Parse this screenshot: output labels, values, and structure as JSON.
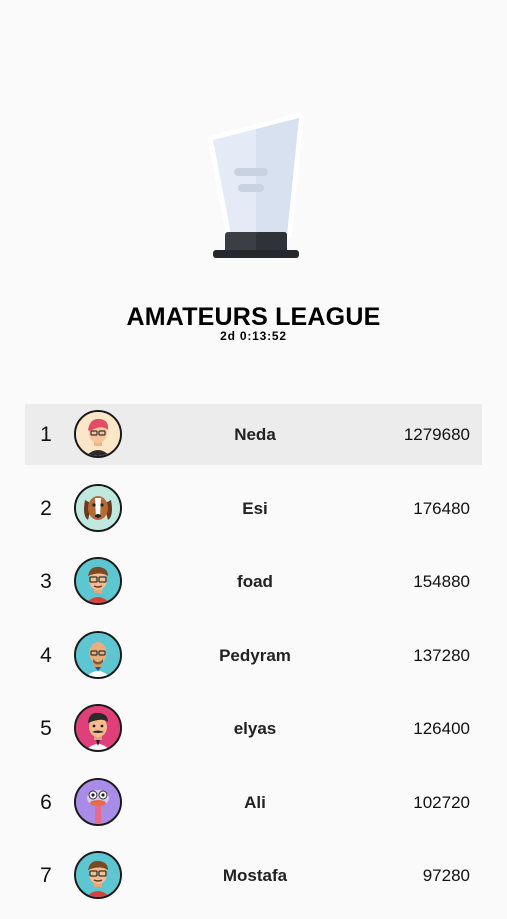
{
  "league": {
    "title": "AMATEURS LEAGUE",
    "timer": "2d 0:13:52",
    "icon": "trophy-icon"
  },
  "colors": {
    "highlight_row": "#ececec",
    "background": "#fafafa"
  },
  "leaderboard": [
    {
      "rank": "1",
      "name": "Neda",
      "score": "1279680",
      "avatar": "woman-red-hair-avatar",
      "avatar_bg": "#fbe6c8",
      "highlight": true
    },
    {
      "rank": "2",
      "name": "Esi",
      "score": "176480",
      "avatar": "dog-avatar",
      "avatar_bg": "#bfe8df",
      "highlight": false
    },
    {
      "rank": "3",
      "name": "foad",
      "score": "154880",
      "avatar": "man-glasses-avatar",
      "avatar_bg": "#5ec6d0",
      "highlight": false
    },
    {
      "rank": "4",
      "name": "Pedyram",
      "score": "137280",
      "avatar": "bald-man-avatar",
      "avatar_bg": "#5ec6d0",
      "highlight": false
    },
    {
      "rank": "5",
      "name": "elyas",
      "score": "126400",
      "avatar": "man-mustache-avatar",
      "avatar_bg": "#e0407a",
      "highlight": false
    },
    {
      "rank": "6",
      "name": "Ali",
      "score": "102720",
      "avatar": "ostrich-avatar",
      "avatar_bg": "#a98ce8",
      "highlight": false
    },
    {
      "rank": "7",
      "name": "Mostafa",
      "score": "97280",
      "avatar": "man-glasses-avatar",
      "avatar_bg": "#5ec6d0",
      "highlight": false
    }
  ]
}
